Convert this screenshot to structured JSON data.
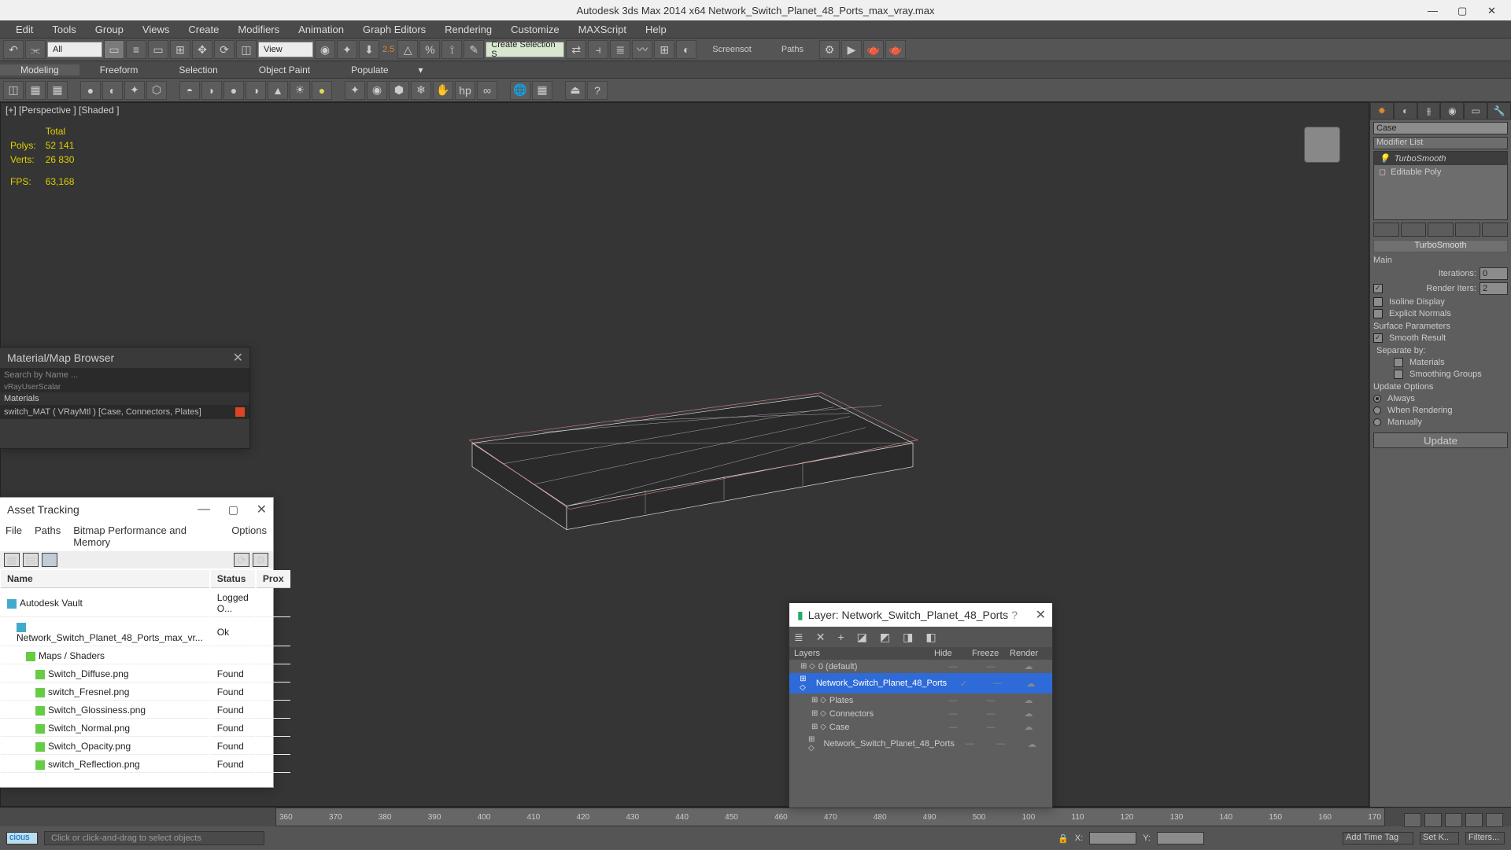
{
  "title": "Autodesk 3ds Max  2014 x64       Network_Switch_Planet_48_Ports_max_vray.max",
  "menu": [
    "Edit",
    "Tools",
    "Group",
    "Views",
    "Create",
    "Modifiers",
    "Animation",
    "Graph Editors",
    "Rendering",
    "Customize",
    "MAXScript",
    "Help"
  ],
  "toolbar1": {
    "dropdown_all": "All",
    "dropdown_view": "View",
    "create_set": "Create Selection S",
    "screenshot": "Screensot",
    "paths": "Paths",
    "scale": "2.5"
  },
  "ribbon": [
    "Modeling",
    "Freeform",
    "Selection",
    "Object Paint",
    "Populate"
  ],
  "viewport": {
    "label": "[+] [Perspective ] [Shaded ]",
    "stats": {
      "total_label": "Total",
      "polys_label": "Polys:",
      "polys": "52 141",
      "verts_label": "Verts:",
      "verts": "26 830",
      "fps_label": "FPS:",
      "fps": "63,168"
    }
  },
  "cmd": {
    "object_name": "Case",
    "modlist_label": "Modifier List",
    "modifiers": [
      "TurboSmooth",
      "Editable Poly"
    ],
    "rollout": "TurboSmooth",
    "main_label": "Main",
    "iter_label": "Iterations:",
    "iter": "0",
    "riter_label": "Render Iters:",
    "riter": "2",
    "riter_chk": true,
    "isoline": "Isoline Display",
    "isoline_chk": false,
    "explicit": "Explicit Normals",
    "explicit_chk": false,
    "surf": "Surface Parameters",
    "smooth": "Smooth Result",
    "smooth_chk": true,
    "sep": "Separate by:",
    "sep_mat": "Materials",
    "sep_sg": "Smoothing Groups",
    "upd": "Update Options",
    "upd_always": "Always",
    "upd_render": "When Rendering",
    "upd_manual": "Manually",
    "upd_btn": "Update"
  },
  "matbrowser": {
    "title": "Material/Map Browser",
    "search": "Search by Name ...",
    "group": "Materials",
    "item": "switch_MAT ( VRayMtl )  [Case, Connectors, Plates]"
  },
  "asset": {
    "title": "Asset Tracking",
    "menu": [
      "File",
      "Paths",
      "Bitmap Performance and Memory",
      "Options"
    ],
    "cols": [
      "Name",
      "Status",
      "Prox"
    ],
    "rows": [
      {
        "n": "Autodesk Vault",
        "s": "Logged O..."
      },
      {
        "n": "Network_Switch_Planet_48_Ports_max_vr...",
        "s": "Ok"
      },
      {
        "n": "Maps / Shaders",
        "s": ""
      },
      {
        "n": "Switch_Diffuse.png",
        "s": "Found"
      },
      {
        "n": "switch_Fresnel.png",
        "s": "Found"
      },
      {
        "n": "Switch_Glossiness.png",
        "s": "Found"
      },
      {
        "n": "Switch_Normal.png",
        "s": "Found"
      },
      {
        "n": "Switch_Opacity.png",
        "s": "Found"
      },
      {
        "n": "switch_Reflection.png",
        "s": "Found"
      }
    ]
  },
  "layer": {
    "title": "Layer: Network_Switch_Planet_48_Ports",
    "cols": [
      "Layers",
      "Hide",
      "Freeze",
      "Render"
    ],
    "rows": [
      {
        "n": "0 (default)",
        "sel": false,
        "ind": 0
      },
      {
        "n": "Network_Switch_Planet_48_Ports",
        "sel": true,
        "ind": 0
      },
      {
        "n": "Plates",
        "sel": false,
        "ind": 1
      },
      {
        "n": "Connectors",
        "sel": false,
        "ind": 1
      },
      {
        "n": "Case",
        "sel": false,
        "ind": 1
      },
      {
        "n": "Network_Switch_Planet_48_Ports",
        "sel": false,
        "ind": 1
      }
    ]
  },
  "timeline": {
    "ticks": [
      "360",
      "370",
      "380",
      "390",
      "400",
      "410",
      "420",
      "430",
      "440",
      "450",
      "460",
      "470",
      "480",
      "490",
      "500",
      "100",
      "110",
      "120",
      "130",
      "140",
      "150",
      "160",
      "170"
    ]
  },
  "statusbar": {
    "prompt": "Click or click-and-drag to select objects",
    "x": "X:",
    "y": "Y:",
    "addtag": "Add Time Tag",
    "setk": "Set K..",
    "filters": "Filters..."
  },
  "script_input": "cious"
}
